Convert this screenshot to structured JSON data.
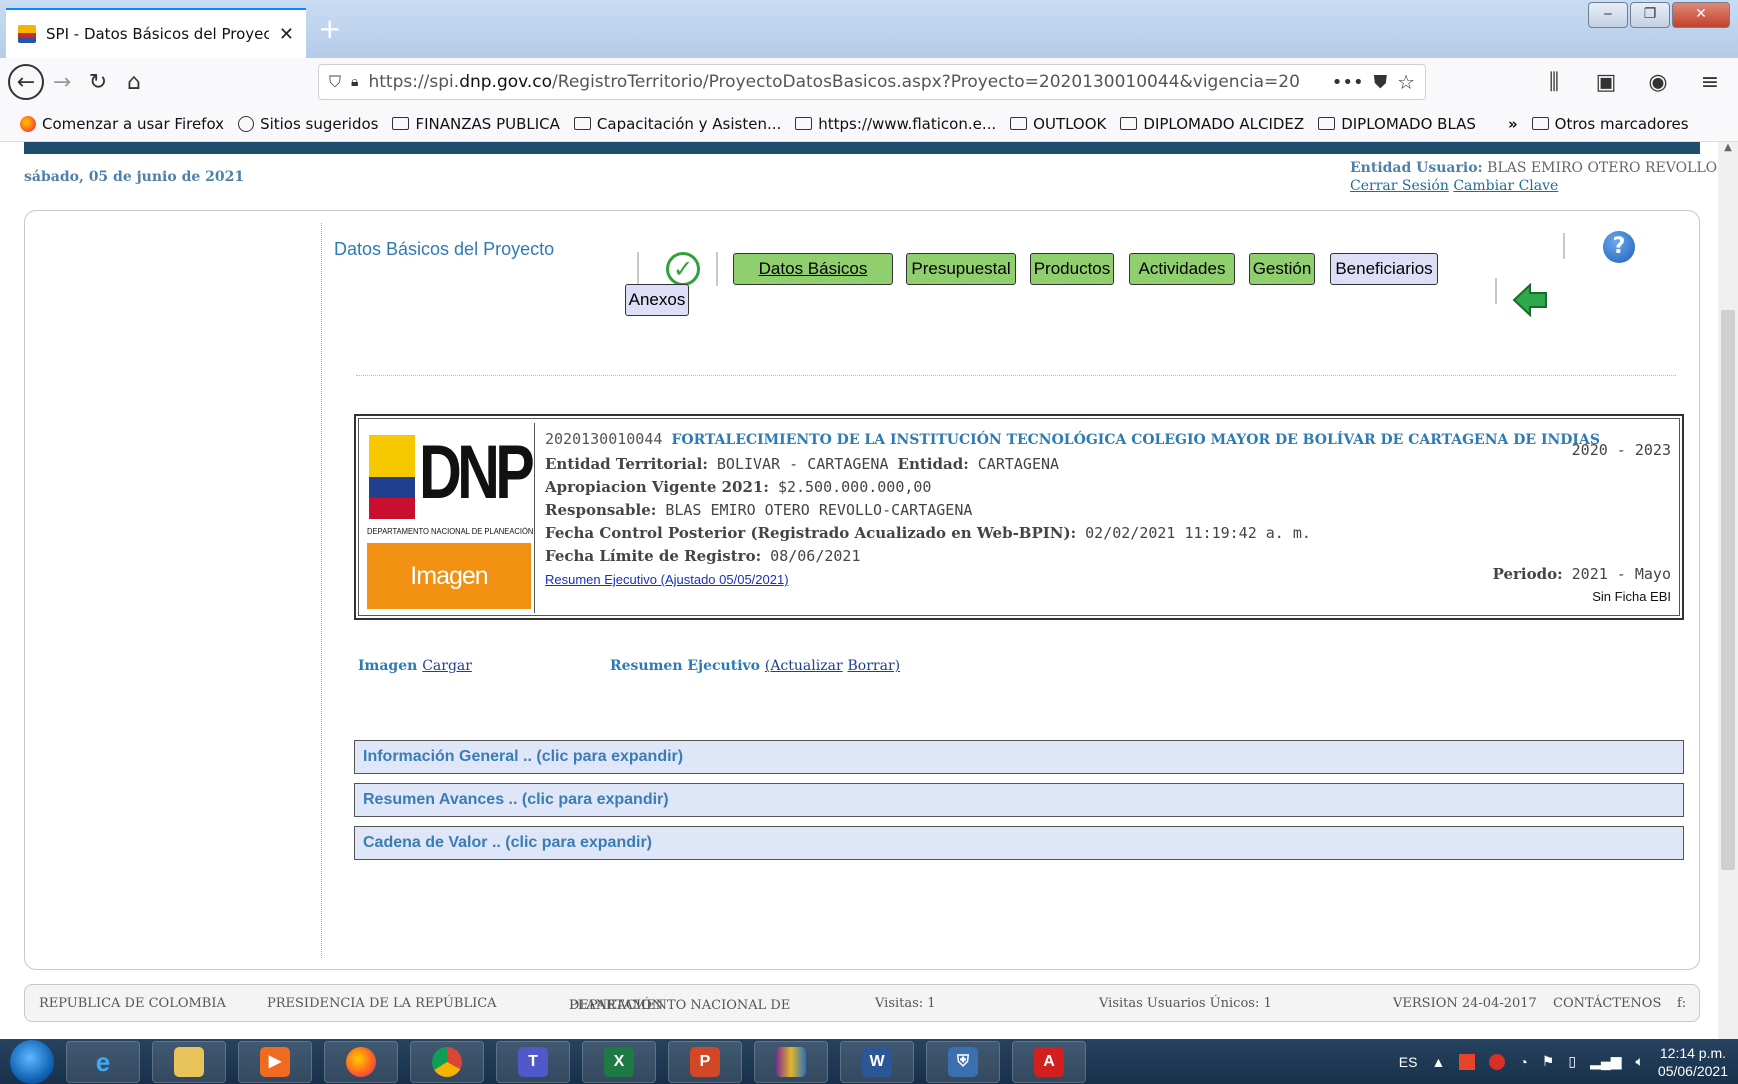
{
  "browser": {
    "tab_title": "SPI - Datos Básicos del Proyecto",
    "url_prefix": "https://spi.",
    "url_domain": "dnp.gov.co",
    "url_path": "/RegistroTerritorio/ProyectoDatosBasicos.aspx?Proyecto=2020130010044&vigencia=20",
    "bookmarks": [
      "Comenzar a usar Firefox",
      "Sitios sugeridos",
      "FINANZAS PUBLICA",
      "Capacitación y Asisten...",
      "https://www.flaticon.e...",
      "OUTLOOK",
      "DIPLOMADO ALCIDEZ",
      "DIPLOMADO BLAS",
      "Otros marcadores"
    ]
  },
  "header": {
    "date": "sábado, 05 de junio de 2021",
    "user_label": "Entidad Usuario:",
    "user_name": "BLAS EMIRO OTERO REVOLLO",
    "logout": "Cerrar Sesión",
    "change_password": "Cambiar Clave"
  },
  "project_nav": {
    "title": "Datos Básicos del Proyecto",
    "buttons": [
      "Datos Básicos",
      "Presupuestal",
      "Productos",
      "Actividades",
      "Gestión",
      "Beneficiarios",
      "Anexos"
    ]
  },
  "project": {
    "logo_text": "DNP",
    "logo_subtitle": "DEPARTAMENTO NACIONAL DE PLANEACIÓN",
    "image_pending": "Imagen pendiente",
    "code": "2020130010044",
    "name": "FORTALECIMIENTO DE LA INSTITUCIÓN TECNOLÓGICA COLEGIO MAYOR DE BOLÍVAR DE CARTAGENA DE INDIAS",
    "years": "2020 - 2023",
    "entidad_territorial_label": "Entidad Territorial:",
    "entidad_territorial": "BOLIVAR - CARTAGENA",
    "entidad_label": "Entidad:",
    "entidad": "CARTAGENA",
    "apropiacion_label": "Apropiacion Vigente 2021:",
    "apropiacion": "$2.500.000.000,00",
    "responsable_label": "Responsable:",
    "responsable": "BLAS EMIRO OTERO REVOLLO-CARTAGENA",
    "fecha_control_label": "Fecha Control Posterior (Registrado Acualizado en Web-BPIN):",
    "fecha_control": "02/02/2021 11:19:42 a. m.",
    "fecha_limite_label": "Fecha Límite de Registro:",
    "fecha_limite": "08/06/2021",
    "periodo_label": "Periodo:",
    "periodo": "2021 - Mayo",
    "resumen_link": "Resumen Ejecutivo (Ajustado 05/05/2021)",
    "sin_ficha": "Sin Ficha EBI"
  },
  "actions": {
    "imagen_label": "Imagen",
    "cargar": "Cargar",
    "resumen_label": "Resumen Ejecutivo",
    "actualizar": "(Actualizar",
    "borrar": "Borrar)"
  },
  "sections": [
    "Información General .. (clic para expandir)",
    "Resumen Avances .. (clic para expandir)",
    "Cadena de Valor .. (clic para expandir)"
  ],
  "footer": {
    "col1": "REPUBLICA DE COLOMBIA",
    "col2": "PRESIDENCIA DE LA REPÚBLICA",
    "col3a": "DEPARTAMENTO NACIONAL DE",
    "col3b": "PLANEACIÓN",
    "visitas": "Visitas: 1",
    "unicos": "Visitas Usuarios Únicos: 1",
    "version": "VERSION 24-04-2017",
    "contact": "CONTÁCTENOS",
    "extra": "f:"
  },
  "taskbar": {
    "lang": "ES",
    "time": "12:14 p.m.",
    "date": "05/06/2021"
  },
  "colors": {
    "accent_blue": "#2e7bb4",
    "nav_green": "#8fcf6e",
    "top_bar": "#1f4d6d"
  }
}
